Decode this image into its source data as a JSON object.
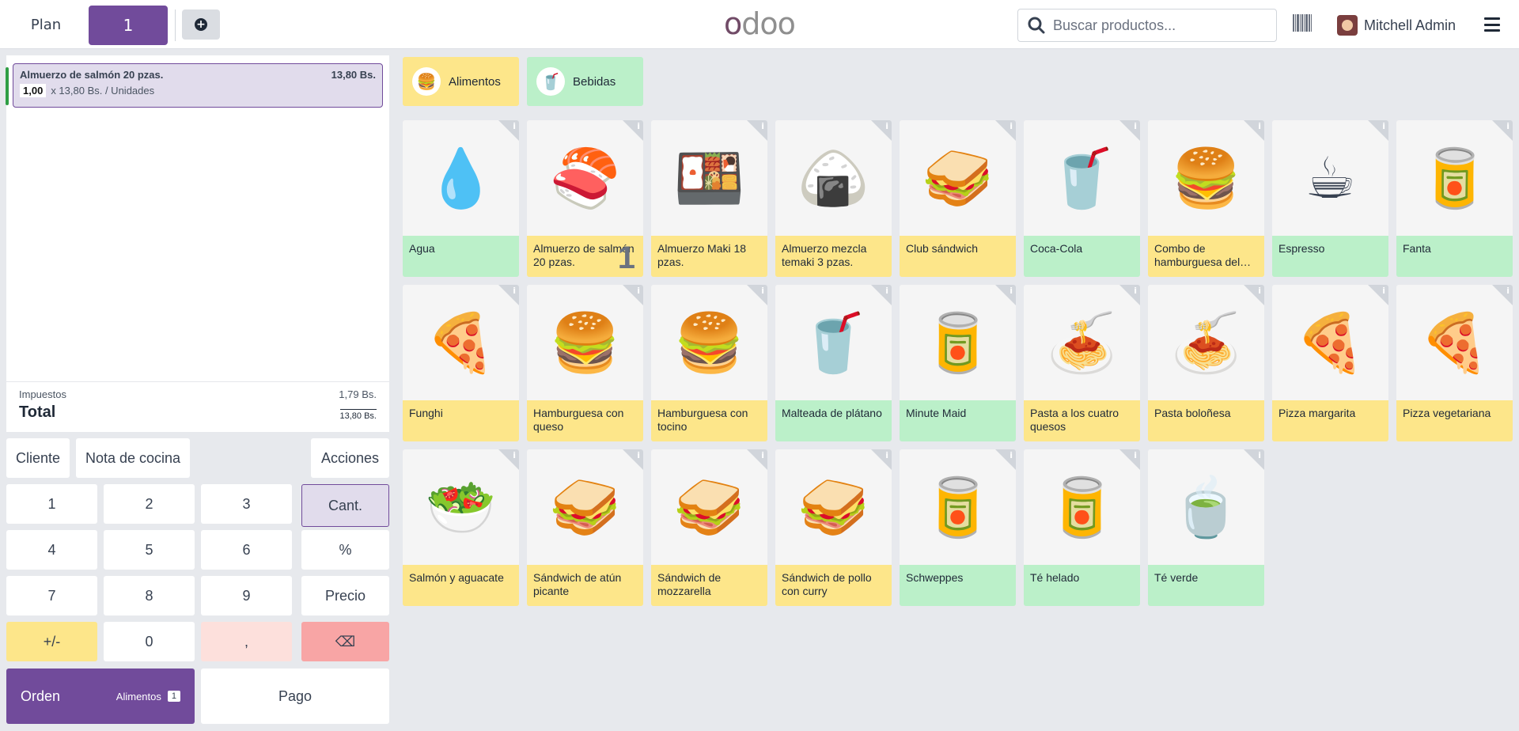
{
  "topbar": {
    "plan_label": "Plan",
    "table_number": "1",
    "add_icon": "plus-circle-icon",
    "logo_text": "odoo",
    "search_placeholder": "Buscar productos...",
    "user_name": "Mitchell Admin"
  },
  "order": {
    "line": {
      "name": "Almuerzo de salmón 20 pzas.",
      "price": "13,80 Bs.",
      "qty": "1,00",
      "unit_text": "x 13,80 Bs. / Unidades"
    },
    "tax_label": "Impuestos",
    "tax_value": "1,79 Bs.",
    "total_label": "Total",
    "total_value": "13,80 Bs."
  },
  "actions": {
    "customer": "Cliente",
    "kitchen_note": "Nota de cocina",
    "actions": "Acciones"
  },
  "numpad": {
    "k1": "1",
    "k2": "2",
    "k3": "3",
    "qty": "Cant.",
    "k4": "4",
    "k5": "5",
    "k6": "6",
    "pct": "%",
    "k7": "7",
    "k8": "8",
    "k9": "9",
    "price": "Precio",
    "plusminus": "+/-",
    "k0": "0",
    "comma": ",",
    "backspace": "⌫"
  },
  "footer": {
    "order_label": "Orden",
    "order_cat": "Alimentos",
    "order_count": "1",
    "pay_label": "Pago"
  },
  "categories": [
    {
      "label": "Alimentos",
      "icon": "food-icon"
    },
    {
      "label": "Bebidas",
      "icon": "drink-icon"
    }
  ],
  "products": [
    {
      "name": "Agua",
      "type": "d"
    },
    {
      "name": "Almuerzo de salmón 20 pzas.",
      "type": "f",
      "qty": "1"
    },
    {
      "name": "Almuerzo Maki 18 pzas.",
      "type": "f"
    },
    {
      "name": "Almuerzo mezcla temaki 3 pzas.",
      "type": "f"
    },
    {
      "name": "Club sándwich",
      "type": "f"
    },
    {
      "name": "Coca-Cola",
      "type": "d"
    },
    {
      "name": "Combo de hamburguesa del…",
      "type": "f"
    },
    {
      "name": "Espresso",
      "type": "d"
    },
    {
      "name": "Fanta",
      "type": "d"
    },
    {
      "name": "Funghi",
      "type": "f"
    },
    {
      "name": "Hamburguesa con queso",
      "type": "f"
    },
    {
      "name": "Hamburguesa con tocino",
      "type": "f"
    },
    {
      "name": "Malteada de plátano",
      "type": "d"
    },
    {
      "name": "Minute Maid",
      "type": "d"
    },
    {
      "name": "Pasta a los cuatro quesos",
      "type": "f"
    },
    {
      "name": "Pasta boloñesa",
      "type": "f"
    },
    {
      "name": "Pizza margarita",
      "type": "f"
    },
    {
      "name": "Pizza vegetariana",
      "type": "f"
    },
    {
      "name": "Salmón y aguacate",
      "type": "f"
    },
    {
      "name": "Sándwich de atún picante",
      "type": "f"
    },
    {
      "name": "Sándwich de mozzarella",
      "type": "f"
    },
    {
      "name": "Sándwich de pollo con curry",
      "type": "f"
    },
    {
      "name": "Schweppes",
      "type": "d"
    },
    {
      "name": "Té helado",
      "type": "d"
    },
    {
      "name": "Té verde",
      "type": "d"
    }
  ]
}
